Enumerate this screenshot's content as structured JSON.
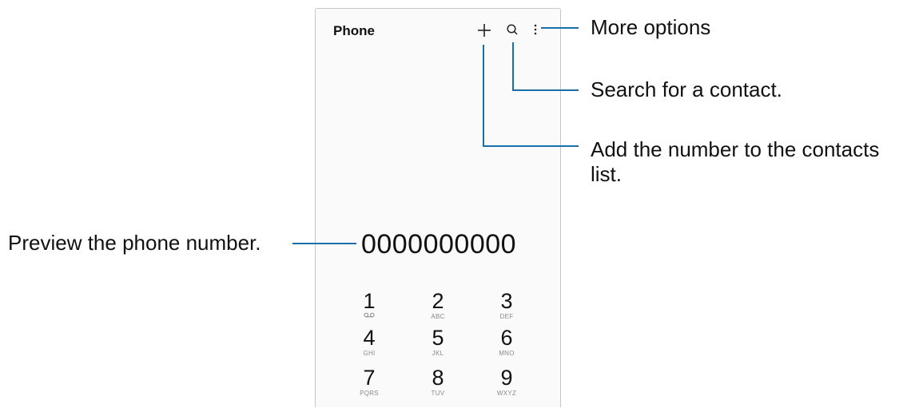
{
  "app": {
    "title": "Phone"
  },
  "toolbar": {
    "add_icon": "plus-icon",
    "search_icon": "search-icon",
    "more_icon": "more-vertical-icon"
  },
  "dialer": {
    "number": "0000000000",
    "keys": [
      {
        "digit": "1",
        "letters": "",
        "icon": "voicemail-icon"
      },
      {
        "digit": "2",
        "letters": "ABC"
      },
      {
        "digit": "3",
        "letters": "DEF"
      },
      {
        "digit": "4",
        "letters": "GHI"
      },
      {
        "digit": "5",
        "letters": "JKL"
      },
      {
        "digit": "6",
        "letters": "MNO"
      },
      {
        "digit": "7",
        "letters": "PQRS"
      },
      {
        "digit": "8",
        "letters": "TUV"
      },
      {
        "digit": "9",
        "letters": "WXYZ"
      }
    ]
  },
  "callouts": {
    "more_options": "More options",
    "search": "Search for a contact.",
    "add_line1": "Add the number to the contacts",
    "add_line2": "list.",
    "preview": "Preview the phone number."
  },
  "colors": {
    "leader_line": "#1a6fa8",
    "screen_bg": "#fafafa"
  }
}
